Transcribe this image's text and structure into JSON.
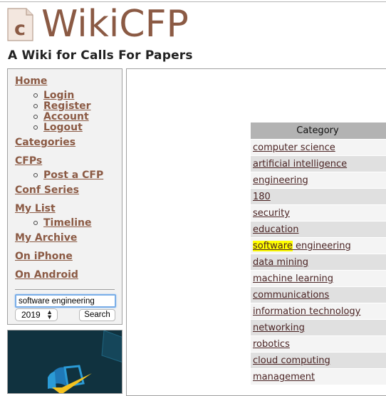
{
  "header": {
    "logo_letter": "c",
    "site_name": "WikiCFP",
    "tagline": "A Wiki for Calls For Papers"
  },
  "sidebar": {
    "nav": {
      "home": "Home",
      "login": "Login",
      "register": "Register",
      "account": "Account",
      "logout": "Logout",
      "categories": "Categories",
      "cfps": "CFPs",
      "post_cfp": "Post a CFP",
      "conf_series": "Conf Series",
      "my_list": "My List",
      "timeline": "Timeline",
      "my_archive": "My Archive",
      "on_iphone": "On iPhone",
      "on_android": "On Android"
    },
    "search": {
      "query": "software engineering",
      "year": "2019",
      "button_label": "Search"
    }
  },
  "category_table": {
    "header": "Category",
    "highlight_term": "software",
    "rows": [
      {
        "label": "computer science"
      },
      {
        "label": "artificial intelligence"
      },
      {
        "label": "engineering"
      },
      {
        "label": "180"
      },
      {
        "label": "security"
      },
      {
        "label": "education"
      },
      {
        "label": "software engineering",
        "highlight": "software",
        "rest": " engineering"
      },
      {
        "label": "data mining"
      },
      {
        "label": "machine learning"
      },
      {
        "label": "communications"
      },
      {
        "label": "information technology"
      },
      {
        "label": "networking"
      },
      {
        "label": "robotics"
      },
      {
        "label": "cloud computing"
      },
      {
        "label": "management"
      }
    ]
  },
  "colors": {
    "brand": "#8b5a44",
    "link": "#4a2323",
    "highlight": "#ffff00",
    "table_header": "#b3b3b3"
  }
}
